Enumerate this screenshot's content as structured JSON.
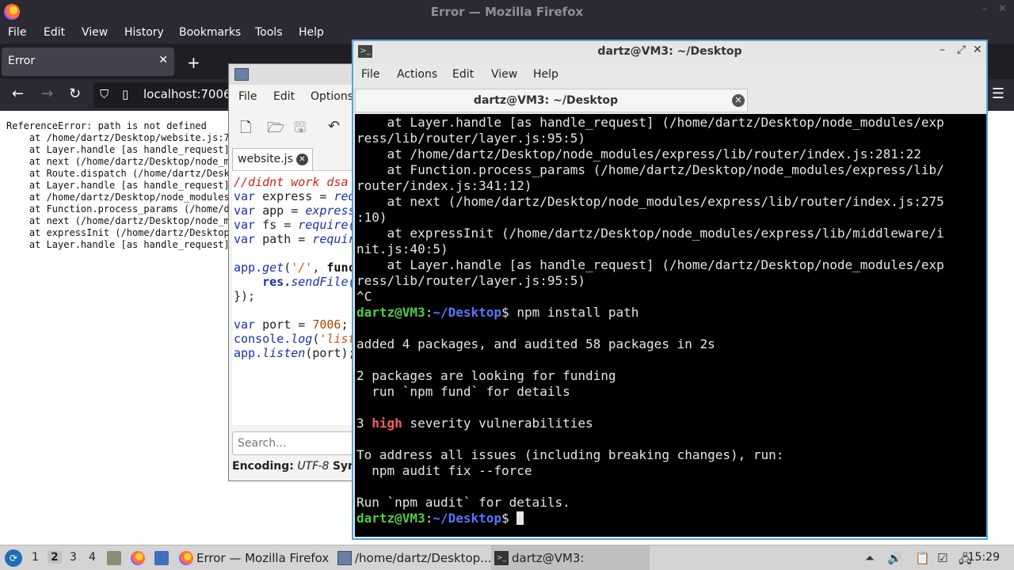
{
  "firefox": {
    "window_title": "Error — Mozilla Firefox",
    "menu": [
      "File",
      "Edit",
      "View",
      "History",
      "Bookmarks",
      "Tools",
      "Help"
    ],
    "tab_title": "Error",
    "url": "localhost:7006",
    "error_text": "ReferenceError: path is not defined\n    at /home/dartz/Desktop/website.js:7\n    at Layer.handle [as handle_request]\n    at next (/home/dartz/Desktop/node_m\n    at Route.dispatch (/home/dartz/Desk\n    at Layer.handle [as handle_request]\n    at /home/dartz/Desktop/node_modules\n    at Function.process_params (/home/d\n    at next (/home/dartz/Desktop/node_m\n    at expressInit (/home/dartz/Desktop\n    at Layer.handle [as handle_request]"
  },
  "mousepad": {
    "menu": [
      "File",
      "Edit",
      "Options"
    ],
    "tab_title": "website.js",
    "search_placeholder": "Search...",
    "encoding_label": "Encoding:",
    "encoding_value": "UTF-8",
    "syntax_label": "Syn",
    "code": {
      "line1": "//didnt work dsa",
      "l2_kw": "var",
      "l2_rest": " express = ",
      "l2_fn": "req",
      "l3_kw": "var",
      "l3_rest": " app = ",
      "l3_fn": "express",
      "l4_kw": "var",
      "l4_rest": " fs = ",
      "l4_fn": "require(",
      "l5_kw": "var",
      "l5_rest": " path = ",
      "l5_fn": "requir",
      "l7_obj": "app.",
      "l7_fn": "get",
      "l7_open": "(",
      "l7_str": "'/'",
      "l7_rest": ", ",
      "l7_kw": "func",
      "l8_indent": "    ",
      "l8_obj": "res.",
      "l8_fn": "sendFile(",
      "l9": "});",
      "l11_kw": "var",
      "l11_rest": " port = ",
      "l11_num": "7006",
      "l11_end": ";",
      "l12_obj": "console.",
      "l12_fn": "log",
      "l12_open": "(",
      "l12_str": "'list",
      "l13_obj": "app.",
      "l13_fn": "listen",
      "l13_rest": "(port);"
    }
  },
  "terminal": {
    "window_title": "dartz@VM3: ~/Desktop",
    "menu": [
      "File",
      "Actions",
      "Edit",
      "View",
      "Help"
    ],
    "tab_title": "dartz@VM3: ~/Desktop",
    "output_top": "    at Layer.handle [as handle_request] (/home/dartz/Desktop/node_modules/exp\nress/lib/router/layer.js:95:5)\n    at /home/dartz/Desktop/node_modules/express/lib/router/index.js:281:22\n    at Function.process_params (/home/dartz/Desktop/node_modules/express/lib/\nrouter/index.js:341:12)\n    at next (/home/dartz/Desktop/node_modules/express/lib/router/index.js:275\n:10)\n    at expressInit (/home/dartz/Desktop/node_modules/express/lib/middleware/i\nnit.js:40:5)\n    at Layer.handle [as handle_request] (/home/dartz/Desktop/node_modules/exp\nress/lib/router/layer.js:95:5)\n^C",
    "prompt_user": "dartz@VM3",
    "prompt_sep": ":",
    "prompt_path": "~/Desktop",
    "prompt_end": "$ ",
    "command": "npm install path",
    "output_mid": "\nadded 4 packages, and audited 58 packages in 2s\n\n2 packages are looking for funding\n  run `npm fund` for details\n",
    "vuln_count": "3 ",
    "vuln_level": "high",
    "vuln_rest": " severity vulnerabilities",
    "output_end": "\nTo address all issues (including breaking changes), run:\n  npm audit fix --force\n\nRun `npm audit` for details."
  },
  "taskbar": {
    "workspaces": [
      "1",
      "2",
      "3",
      "4"
    ],
    "tasks": [
      "Error — Mozilla Firefox",
      "/home/dartz/Desktop...",
      "dartz@VM3: ~/Desktop"
    ],
    "clock": "15:29"
  }
}
